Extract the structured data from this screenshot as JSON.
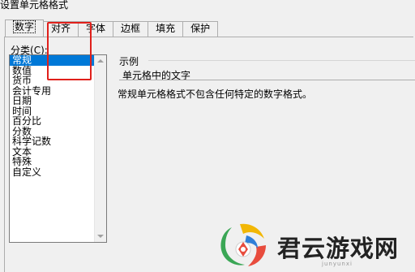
{
  "window": {
    "title": "设置单元格格式"
  },
  "tabs": [
    {
      "label": "数字",
      "active": true
    },
    {
      "label": "对齐",
      "active": false
    },
    {
      "label": "字体",
      "active": false
    },
    {
      "label": "边框",
      "active": false
    },
    {
      "label": "填充",
      "active": false
    },
    {
      "label": "保护",
      "active": false
    }
  ],
  "category": {
    "label_text": "分类(",
    "label_key": "C",
    "label_suffix": "):",
    "items": [
      "常规",
      "数值",
      "货币",
      "会计专用",
      "日期",
      "时间",
      "百分比",
      "分数",
      "科学记数",
      "文本",
      "特殊",
      "自定义"
    ],
    "selected": "常规"
  },
  "sample": {
    "title": "示例",
    "value": "单元格中的文字"
  },
  "description": "常规单元格格式不包含任何特定的数字格式。",
  "highlight_color": "#e0201b",
  "selection_color": "#0078d7",
  "watermark": {
    "name": "君云游戏网",
    "sub": "junyunxi"
  }
}
